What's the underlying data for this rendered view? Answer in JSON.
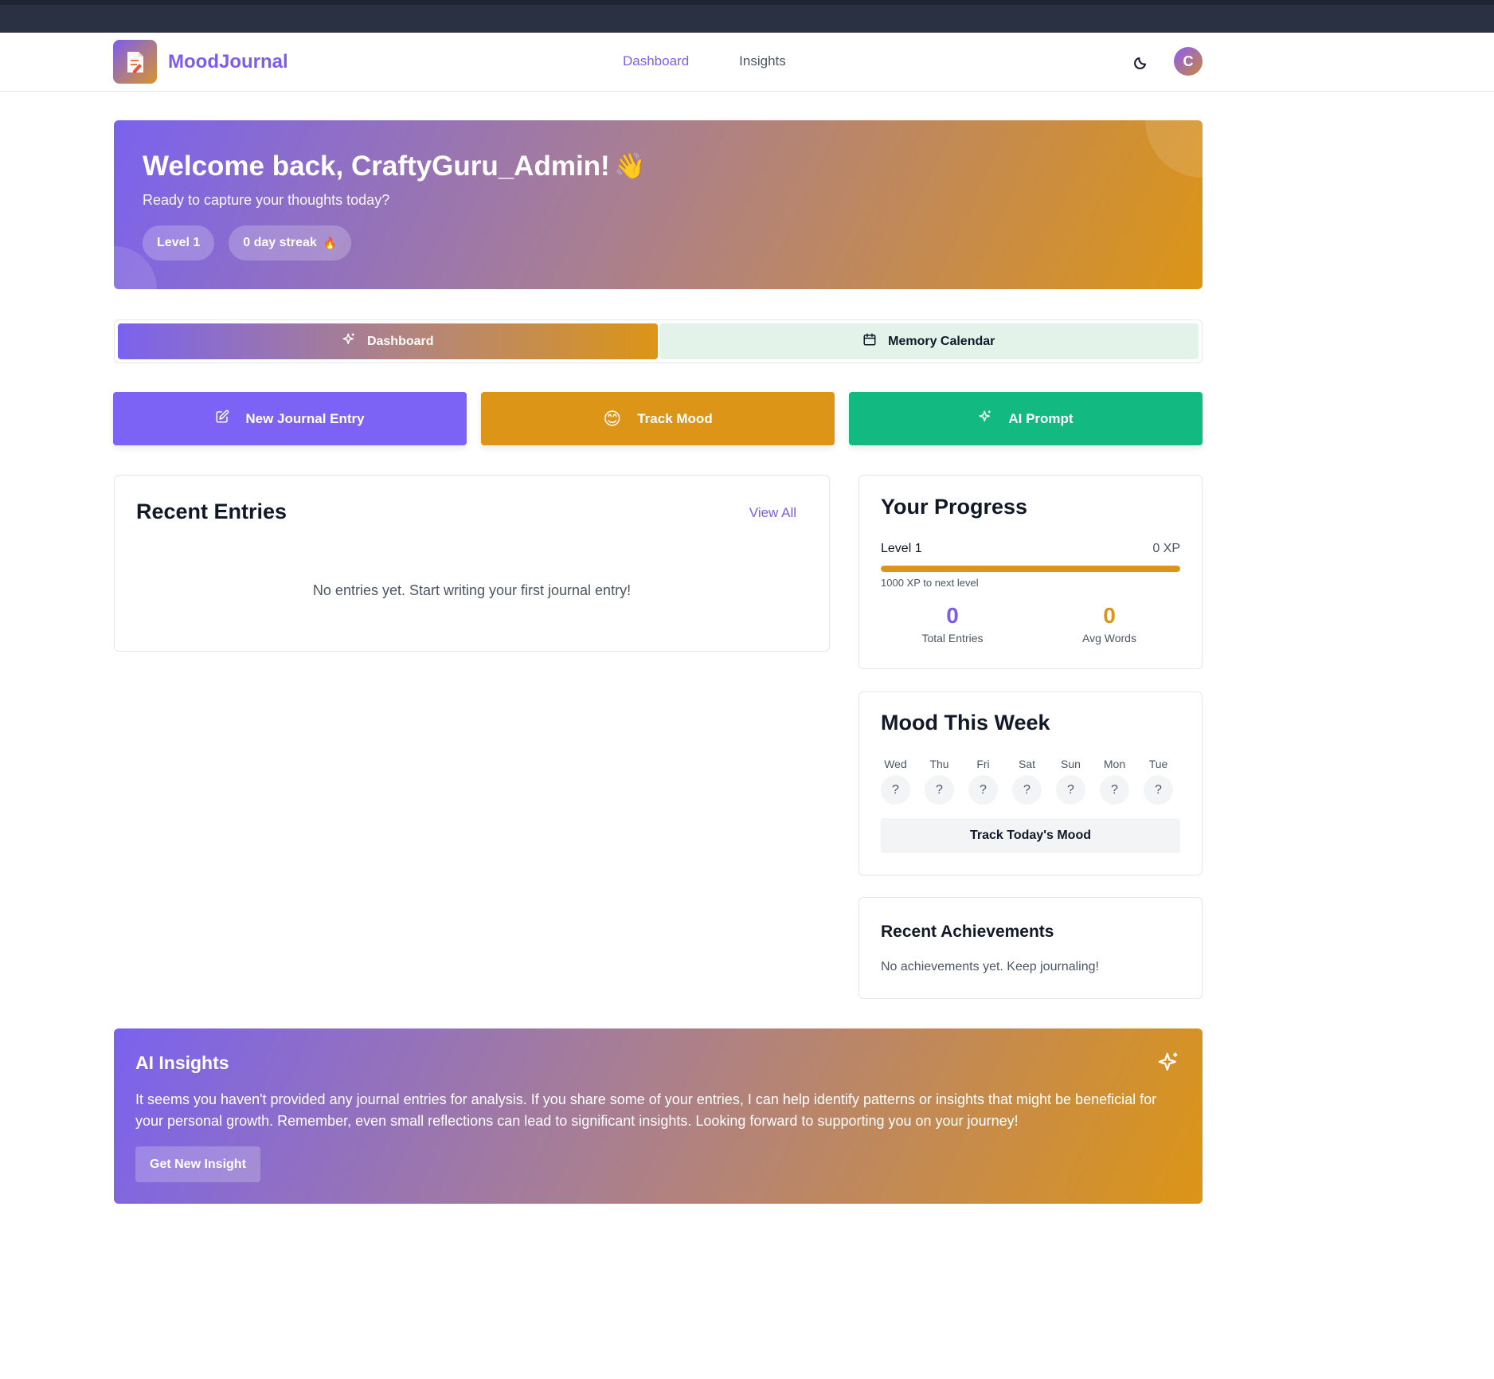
{
  "brand": {
    "name": "MoodJournal"
  },
  "nav": {
    "links": [
      {
        "label": "Dashboard",
        "active": true
      },
      {
        "label": "Insights",
        "active": false
      }
    ]
  },
  "user": {
    "avatar_initial": "C"
  },
  "hero": {
    "title": "Welcome back, CraftyGuru_Admin!",
    "wave": "👋",
    "subtitle": "Ready to capture your thoughts today?",
    "level_badge": "Level 1",
    "streak_badge": "0 day streak",
    "streak_icon": "🔥"
  },
  "tabs": [
    {
      "label": "Dashboard",
      "icon": "sparkles-icon",
      "active": true
    },
    {
      "label": "Memory Calendar",
      "icon": "calendar-icon",
      "active": false
    }
  ],
  "actions": {
    "journal": {
      "label": "New Journal Entry",
      "icon": "edit-icon"
    },
    "mood": {
      "label": "Track Mood",
      "icon": "😊"
    },
    "ai": {
      "label": "AI Prompt",
      "icon": "sparkles-icon"
    }
  },
  "recent": {
    "title": "Recent Entries",
    "view_all": "View All",
    "empty": "No entries yet. Start writing your first journal entry!"
  },
  "progress": {
    "title": "Your Progress",
    "level": "Level 1",
    "xp": "0 XP",
    "progress_fraction": 1.0,
    "next": "1000 XP to next level",
    "total_entries_value": "0",
    "total_entries_label": "Total Entries",
    "avg_words_value": "0",
    "avg_words_label": "Avg Words"
  },
  "mood_week": {
    "title": "Mood This Week",
    "days": [
      {
        "name": "Wed",
        "value": "?"
      },
      {
        "name": "Thu",
        "value": "?"
      },
      {
        "name": "Fri",
        "value": "?"
      },
      {
        "name": "Sat",
        "value": "?"
      },
      {
        "name": "Sun",
        "value": "?"
      },
      {
        "name": "Mon",
        "value": "?"
      },
      {
        "name": "Tue",
        "value": "?"
      }
    ],
    "track_button": "Track Today's Mood"
  },
  "achievements": {
    "title": "Recent Achievements",
    "empty": "No achievements yet. Keep journaling!"
  },
  "ai_insights": {
    "title": "AI Insights",
    "text": "It seems you haven't provided any journal entries for analysis. If you share some of your entries, I can help identify patterns or insights that might be beneficial for your personal growth. Remember, even small reflections can lead to significant insights. Looking forward to supporting you on your journey!",
    "button": "Get New Insight"
  },
  "colors": {
    "accent_purple": "#7c5cf0",
    "accent_orange": "#dc9516",
    "accent_green": "#12b981"
  }
}
